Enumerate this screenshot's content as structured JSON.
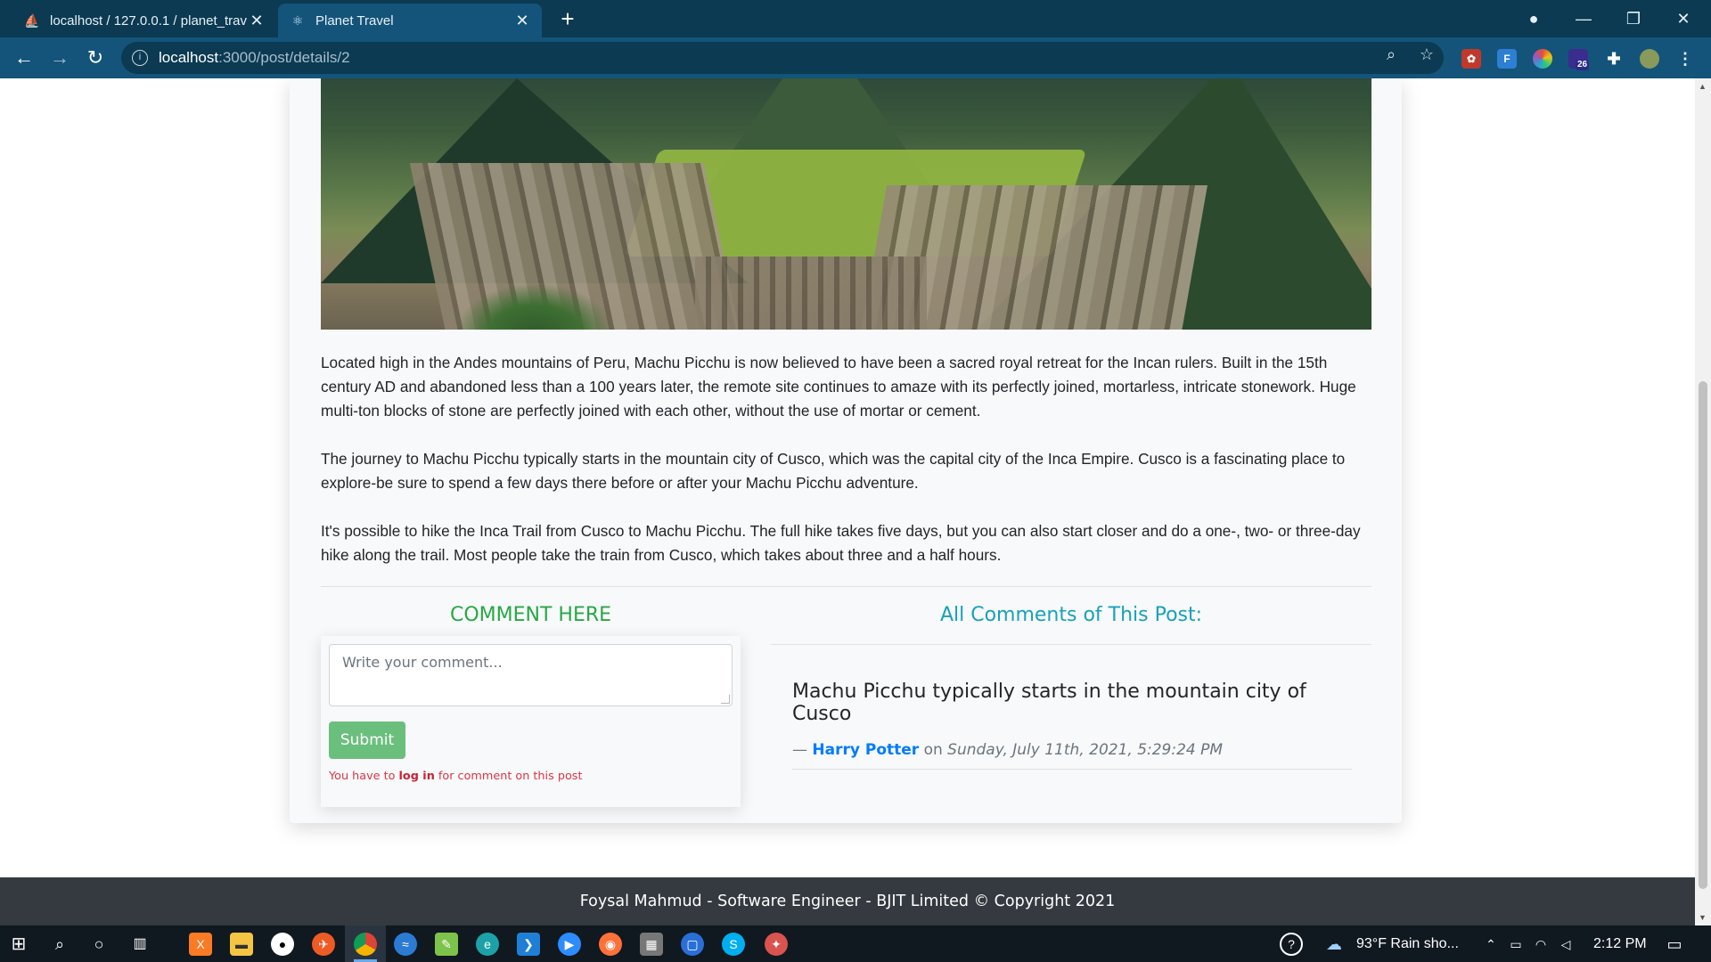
{
  "browser": {
    "tabs": [
      {
        "title": "localhost / 127.0.0.1 / planet_trav",
        "icon": "phpmyadmin-icon"
      },
      {
        "title": "Planet Travel",
        "icon": "react-icon"
      }
    ],
    "url_host": "localhost",
    "url_path": ":3000/post/details/2",
    "extension_badge": "26"
  },
  "article": {
    "paragraphs": [
      "Located high in the Andes mountains of Peru, Machu Picchu is now believed to have been a sacred royal retreat for the Incan rulers. Built in the 15th century AD and abandoned less than a 100 years later, the remote site continues to amaze with its perfectly joined, mortarless, intricate stonework. Huge multi-ton blocks of stone are perfectly joined with each other, without the use of mortar or cement.",
      "The journey to Machu Picchu typically starts in the mountain city of Cusco, which was the capital city of the Inca Empire. Cusco is a fascinating place to explore-be sure to spend a few days there before or after your Machu Picchu adventure.",
      "It's possible to hike the Inca Trail from Cusco to Machu Picchu. The full hike takes five days, but you can also start closer and do a one-, two- or three-day hike along the trail. Most people take the train from Cusco, which takes about three and a half hours."
    ]
  },
  "comment_form": {
    "heading": "COMMENT HERE",
    "placeholder": "Write your comment...",
    "submit_label": "Submit",
    "note_prefix": "You have to ",
    "note_link": "log in",
    "note_suffix": " for comment on this post"
  },
  "comments": {
    "heading": "All Comments of This Post:",
    "items": [
      {
        "text": "Machu Picchu typically starts in the mountain city of Cusco",
        "dash": "— ",
        "author": "Harry Potter",
        "on": " on ",
        "date": "Sunday, July 11th, 2021, 5:29:24 PM"
      }
    ]
  },
  "footer": {
    "text": "Foysal Mahmud - Software Engineer - BJIT Limited © Copyright 2021"
  },
  "taskbar": {
    "weather": "93°F  Rain sho...",
    "time": "2:12 PM"
  },
  "colors": {
    "browser_frame": "#0b3a52",
    "toolbar": "#14547a",
    "comment_heading": "#28a745",
    "comments_heading": "#17a2b8",
    "author_link": "#007bff",
    "error_text": "#dc3545",
    "footer_bg": "#343a40"
  }
}
